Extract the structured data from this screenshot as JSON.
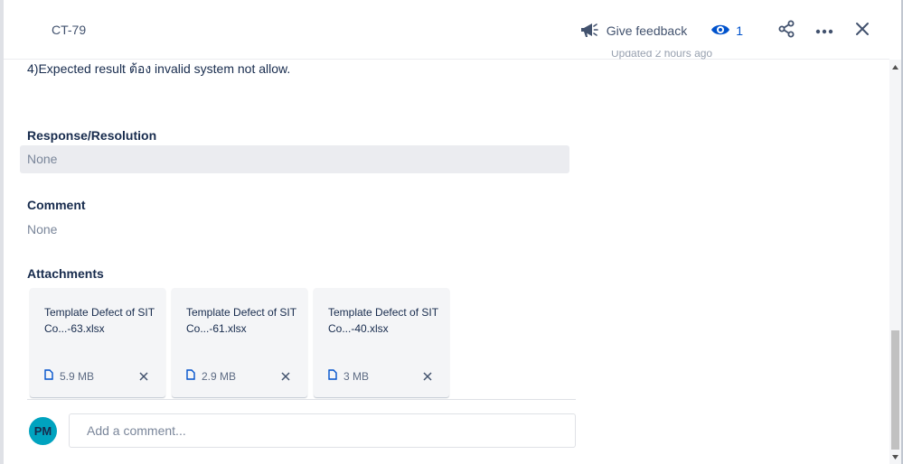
{
  "header": {
    "issue_key": "CT-79",
    "feedback_label": "Give feedback",
    "watchers_count": "1"
  },
  "activity": {
    "updated_text": "Updated 2 hours ago"
  },
  "description": {
    "line": "4)Expected result ต้อง invalid system not allow."
  },
  "fields": {
    "response_resolution": {
      "label": "Response/Resolution",
      "value": "None"
    },
    "comment": {
      "label": "Comment",
      "value": "None"
    },
    "attachments_label": "Attachments"
  },
  "attachments": [
    {
      "name": "Template Defect of SIT Co...-63.xlsx",
      "size": "5.9 MB"
    },
    {
      "name": "Template Defect of SIT Co...-61.xlsx",
      "size": "2.9 MB"
    },
    {
      "name": "Template Defect of SIT Co...-40.xlsx",
      "size": "3 MB"
    }
  ],
  "comment_box": {
    "avatar_initials": "PM",
    "placeholder": "Add a comment..."
  },
  "colors": {
    "accent": "#0052cc",
    "avatar_bg": "#00a3bf",
    "field_bg": "#ebecf0"
  }
}
